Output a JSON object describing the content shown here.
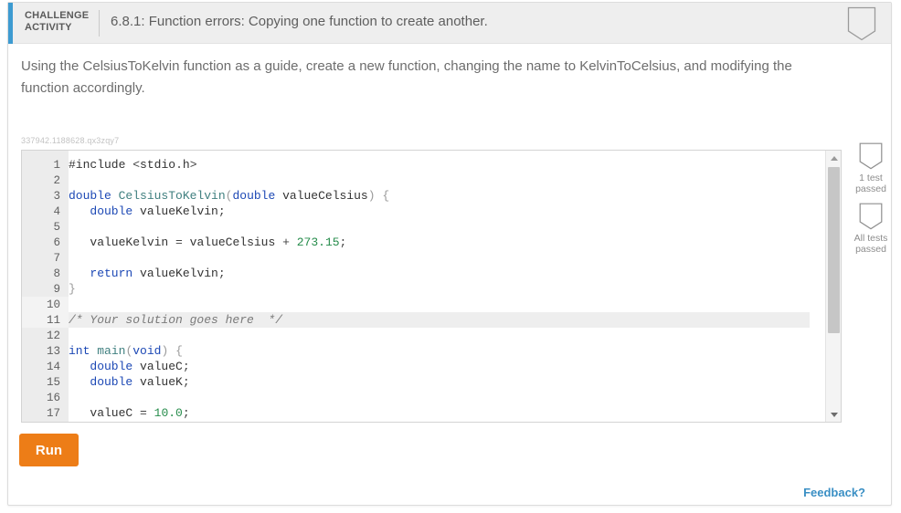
{
  "header": {
    "kicker_line1": "CHALLENGE",
    "kicker_line2": "ACTIVITY",
    "title": "6.8.1: Function errors: Copying one function to create another.",
    "accent_color": "#3d9bd1",
    "bookmark_icon": "bookmark-icon"
  },
  "instruction": {
    "text": "Using the CelsiusToKelvin function as a guide, create a new function, changing the name to KelvinToCelsius, and modifying the function accordingly."
  },
  "editor": {
    "watermark": "337942.1188628.qx3zqy7",
    "lines": [
      {
        "num": "1",
        "text": "#include <stdio.h>"
      },
      {
        "num": "2",
        "text": ""
      },
      {
        "num": "3",
        "text": "double CelsiusToKelvin(double valueCelsius) {"
      },
      {
        "num": "4",
        "text": "   double valueKelvin;"
      },
      {
        "num": "5",
        "text": ""
      },
      {
        "num": "6",
        "text": "   valueKelvin = valueCelsius + 273.15;"
      },
      {
        "num": "7",
        "text": ""
      },
      {
        "num": "8",
        "text": "   return valueKelvin;"
      },
      {
        "num": "9",
        "text": "}"
      },
      {
        "num": "10",
        "text": ""
      },
      {
        "num": "11",
        "text": "/* Your solution goes here  */"
      },
      {
        "num": "12",
        "text": ""
      },
      {
        "num": "13",
        "text": "int main(void) {"
      },
      {
        "num": "14",
        "text": "   double valueC;"
      },
      {
        "num": "15",
        "text": "   double valueK;"
      },
      {
        "num": "16",
        "text": ""
      },
      {
        "num": "17",
        "text": "   valueC = 10.0;"
      }
    ],
    "scrollbar": {
      "up_arrow": "chevron-up-icon",
      "down_arrow": "chevron-down-icon"
    }
  },
  "actions": {
    "run_label": "Run",
    "run_color": "#ed7d17",
    "feedback_label": "Feedback?",
    "feedback_color": "#3a8fc4"
  },
  "test_panel": {
    "items": [
      {
        "icon": "shield-icon",
        "line1": "1 test",
        "line2": "passed"
      },
      {
        "icon": "shield-icon",
        "line1": "All tests",
        "line2": "passed"
      }
    ]
  }
}
